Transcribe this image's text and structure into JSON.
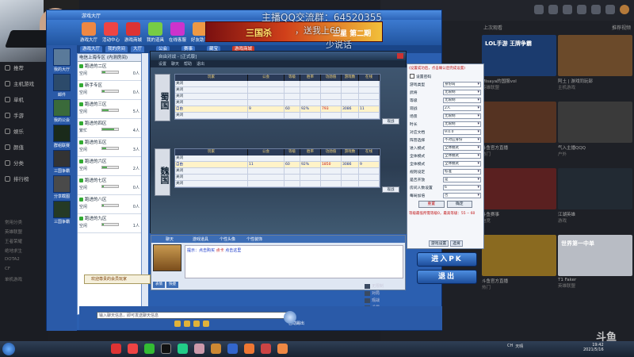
{
  "overlay": {
    "line1": "主播QQ交流群：64520355",
    "line2": "，送我上60",
    "line3": "少说话"
  },
  "app": {
    "title": "游戏大厅",
    "nav": [
      {
        "label": "游戏大厅"
      },
      {
        "label": "活动中心"
      },
      {
        "label": "游戏商城"
      },
      {
        "label": "我的道具"
      },
      {
        "label": "在线客服"
      },
      {
        "label": "好友助手"
      }
    ],
    "banner_main": "三国杀",
    "banner_sub": "三星 第二期",
    "tabs": [
      "游戏大厅",
      "我的房间",
      "大厅",
      "公会",
      "赛事",
      "藏宝",
      "游戏商城"
    ],
    "left_items": [
      "我的大厅",
      "邮件",
      "我的公会",
      "群组联赛",
      "三国争霸",
      "分享截图",
      "三国争霸"
    ],
    "rooms_header": "电信上海专区 (内测房间)",
    "rooms": [
      {
        "name": "跑进的二区",
        "status": "空闲",
        "count": "0人",
        "fill": 0.2
      },
      {
        "name": "新手专区",
        "status": "空闲",
        "count": "0人",
        "fill": 0.15
      },
      {
        "name": "跑进的三区",
        "status": "空闲",
        "count": "5人",
        "fill": 0.4
      },
      {
        "name": "跑进的四区",
        "status": "繁忙",
        "count": "4人",
        "fill": 0.75
      },
      {
        "name": "跑进的五区",
        "status": "空闲",
        "count": "3人",
        "fill": 0.25
      },
      {
        "name": "跑进的六区",
        "status": "空闲",
        "count": "2人",
        "fill": 0.3
      },
      {
        "name": "跑进的七区",
        "status": "空闲",
        "count": "0人",
        "fill": 0.1
      },
      {
        "name": "跑进的八区",
        "status": "空闲",
        "count": "0人",
        "fill": 0.1
      },
      {
        "name": "跑进的九区",
        "status": "空闲",
        "count": "1人",
        "fill": 0.12
      }
    ],
    "welcome": "欢迎尊贵的会员玩家"
  },
  "board": {
    "title": "自由对战 - [正式版]",
    "menu": [
      "设置",
      "聊天",
      "帮助",
      "退出"
    ],
    "headers": [
      "玩家",
      "公会",
      "等级",
      "胜率",
      "功勋值",
      "游戏数",
      "在线"
    ],
    "factions": [
      "蜀国",
      "魏国"
    ],
    "shu_rows": [
      "关闭",
      "关闭",
      "关闭",
      "关闭",
      "关闭"
    ],
    "shu_player": {
      "name": "自由",
      "guild": "9",
      "level": "60",
      "rate": "92%",
      "merit": "793",
      "games": "3086",
      "tag": "11"
    },
    "wei_rows": [
      "关闭",
      "关闭",
      "关闭",
      "关闭"
    ],
    "wei_player": {
      "name": "自由",
      "guild": "11",
      "level": "60",
      "rate": "92%",
      "merit": "1850",
      "games": "3086",
      "tag": "9"
    },
    "side_btn": "观战"
  },
  "settings": {
    "note": "(设置成功后，点击确认后完成设置)",
    "rows": [
      {
        "label": "设置密码",
        "value": "",
        "checkbox": true
      },
      {
        "label": "游戏类型",
        "value": "身份局"
      },
      {
        "label": "武将",
        "value": "无限制"
      },
      {
        "label": "等级",
        "value": "无限制"
      },
      {
        "label": "观战",
        "value": "2人"
      },
      {
        "label": "场景",
        "value": "无限制"
      },
      {
        "label": "时长",
        "value": "无限制"
      },
      {
        "label": "对应文档",
        "value": "9.0.0"
      },
      {
        "label": "阵营选择",
        "value": "不对应身份"
      },
      {
        "label": "进入模式",
        "value": "全体模式"
      },
      {
        "label": "全体模式",
        "value": "全体模式"
      },
      {
        "label": "全体模式",
        "value": "全体模式"
      },
      {
        "label": "规则设定",
        "value": "标准"
      },
      {
        "label": "是否开放",
        "value": "是"
      },
      {
        "label": "房间人数设置",
        "value": "6"
      },
      {
        "label": "每局加倍",
        "value": "否"
      }
    ],
    "buttons": [
      "重置",
      "确定"
    ],
    "foot": "等级最低所需等级0，最高等级：55 -- 60",
    "tabs": [
      "游戏设置",
      "选将"
    ]
  },
  "chat": {
    "tabs": [
      "聊天",
      "游戏道具",
      "个性头像",
      "个性装饰"
    ],
    "message_prefix": "提示：点击购买",
    "message_highlight": "点卡",
    "message_suffix": "点击这里",
    "buttons": [
      "表情",
      "快捷"
    ]
  },
  "buttons": {
    "enter_pk": "进入PK",
    "exit": "退出"
  },
  "bottom": {
    "input_placeholder": "输入聊天信息，即可发送聊天信息",
    "checkbox_label": "自动踢出"
  },
  "site": {
    "row_left": "上次观看",
    "row_right": "推荐视频",
    "cards": [
      {
        "title": "LOL手游 王牌争霸",
        "meta": "Misaya的国服vol",
        "sub": "英雄联盟"
      },
      {
        "title": "",
        "meta": "阿土 | 游戏同玩部",
        "sub": "主机游戏"
      },
      {
        "title": "",
        "meta": "斗鱼官方直播",
        "sub": "热门"
      },
      {
        "title": "",
        "meta": "气入主播QQQ",
        "sub": "户外"
      },
      {
        "title": "",
        "meta": "斗鱼赛事",
        "sub": "电竞"
      },
      {
        "title": "",
        "meta": "江湖英雄",
        "sub": "游戏"
      },
      {
        "title": "",
        "meta": "斗鱼官方直播",
        "sub": "热门"
      },
      {
        "title": "世界第一中单",
        "meta": "T1 Faker",
        "sub": "英雄联盟"
      }
    ]
  },
  "left_sidebar": {
    "items": [
      "推荐",
      "主机游戏",
      "单机",
      "手游",
      "娱乐",
      "颜值",
      "分类",
      "排行榜"
    ],
    "bottom": [
      "常用分类",
      "英雄联盟",
      "王者荣耀",
      "绝地求生",
      "DOTA2",
      "CF",
      "单机游戏"
    ]
  },
  "midlist": [
    "无限制",
    "对局",
    "观战",
    "设置"
  ],
  "taskbar": {
    "tray_text": "CH",
    "weather": "天晴",
    "time": "19:42",
    "date": "2021/5/16"
  },
  "watermark": "斗鱼"
}
